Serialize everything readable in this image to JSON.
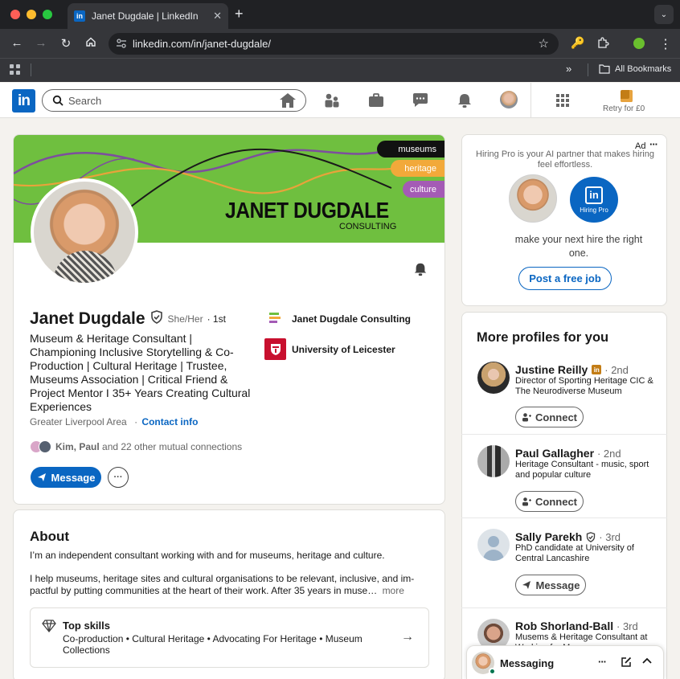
{
  "browser": {
    "tab_title": "Janet Dugdale | LinkedIn",
    "url": "linkedin.com/in/janet-dugdale/",
    "bookmarks_label": "All Bookmarks",
    "tab_favicon": "in"
  },
  "nav": {
    "logo": "in",
    "search_placeholder": "Search",
    "premium_label": "Retry for £0",
    "icons": [
      "home-icon",
      "network-icon",
      "jobs-icon",
      "messaging-icon",
      "notifications-icon",
      "me-avatar",
      "work-grid-icon"
    ]
  },
  "banner": {
    "tags": [
      "museums",
      "heritage",
      "culture"
    ],
    "title": "JANET DUGDALE",
    "subtitle": "CONSULTING"
  },
  "profile": {
    "name": "Janet Dugdale",
    "pronouns": "She/Her",
    "degree": "· 1st",
    "headline": "Museum & Heritage Consultant | Championing Inclusive Storytelling & Co-Production | Cultural Heritage | Trustee, Museums Association | Critical Friend & Project Mentor I 35+ Years Creating Cultural Experiences",
    "location": "Greater Liverpool Area",
    "contact_sep": "·",
    "contact_label": "Contact info",
    "mutual_names": "Kim, Paul",
    "mutual_rest": " and 22 other mutual connections",
    "message_label": "Message",
    "more_label": "···",
    "companies": [
      {
        "name": "Janet Dugdale Consulting"
      },
      {
        "name": "University of Leicester"
      }
    ]
  },
  "about": {
    "title": "About",
    "para1": "I’m an independent consultant working with and for museums, heritage and culture.",
    "para2a": "I help museums, heritage sites and cultural organisations to be relevant, inclusive, and im-",
    "para2b": "pactful by putting communities at the heart of their work. After 35 years in muse…",
    "more": "more",
    "skills_title": "Top skills",
    "skills_line1": "Co-production • Cultural Heritage • Advocating For Heritage • Museum",
    "skills_line2": "Collections"
  },
  "ad": {
    "ad_label": "Ad",
    "text1": "Hiring Pro is your AI partner that makes hiring",
    "text2": "feel effortless.",
    "badge_logo": "in",
    "badge_text": "Hiring Pro",
    "cta1": "make your next hire the right",
    "cta2": "one.",
    "button": "Post a free job"
  },
  "more_profiles": {
    "title": "More profiles for you",
    "people": [
      {
        "name": "Justine Reilly",
        "degree": "· 2nd",
        "line1": "Director of Sporting Heritage CIC &",
        "line2": "The Neurodiverse Museum",
        "action": "Connect"
      },
      {
        "name": "Paul Gallagher",
        "degree": "· 2nd",
        "line1": "Heritage Consultant - music, sport",
        "line2": "and popular culture",
        "action": "Connect"
      },
      {
        "name": "Sally Parekh",
        "degree": "· 3rd",
        "line1": "PhD candidate at University of",
        "line2": "Central Lancashire",
        "action": "Message"
      },
      {
        "name": "Rob Shorland-Ball",
        "degree": "· 3rd",
        "line1": "Musems & Heritage Consultant at",
        "line2": "Working for Museums"
      }
    ]
  },
  "messaging": {
    "label": "Messaging"
  },
  "colors": {
    "linkedin_blue": "#0a66c2",
    "banner_green": "#6fbf3f",
    "premium_gold": "#c37d16"
  }
}
